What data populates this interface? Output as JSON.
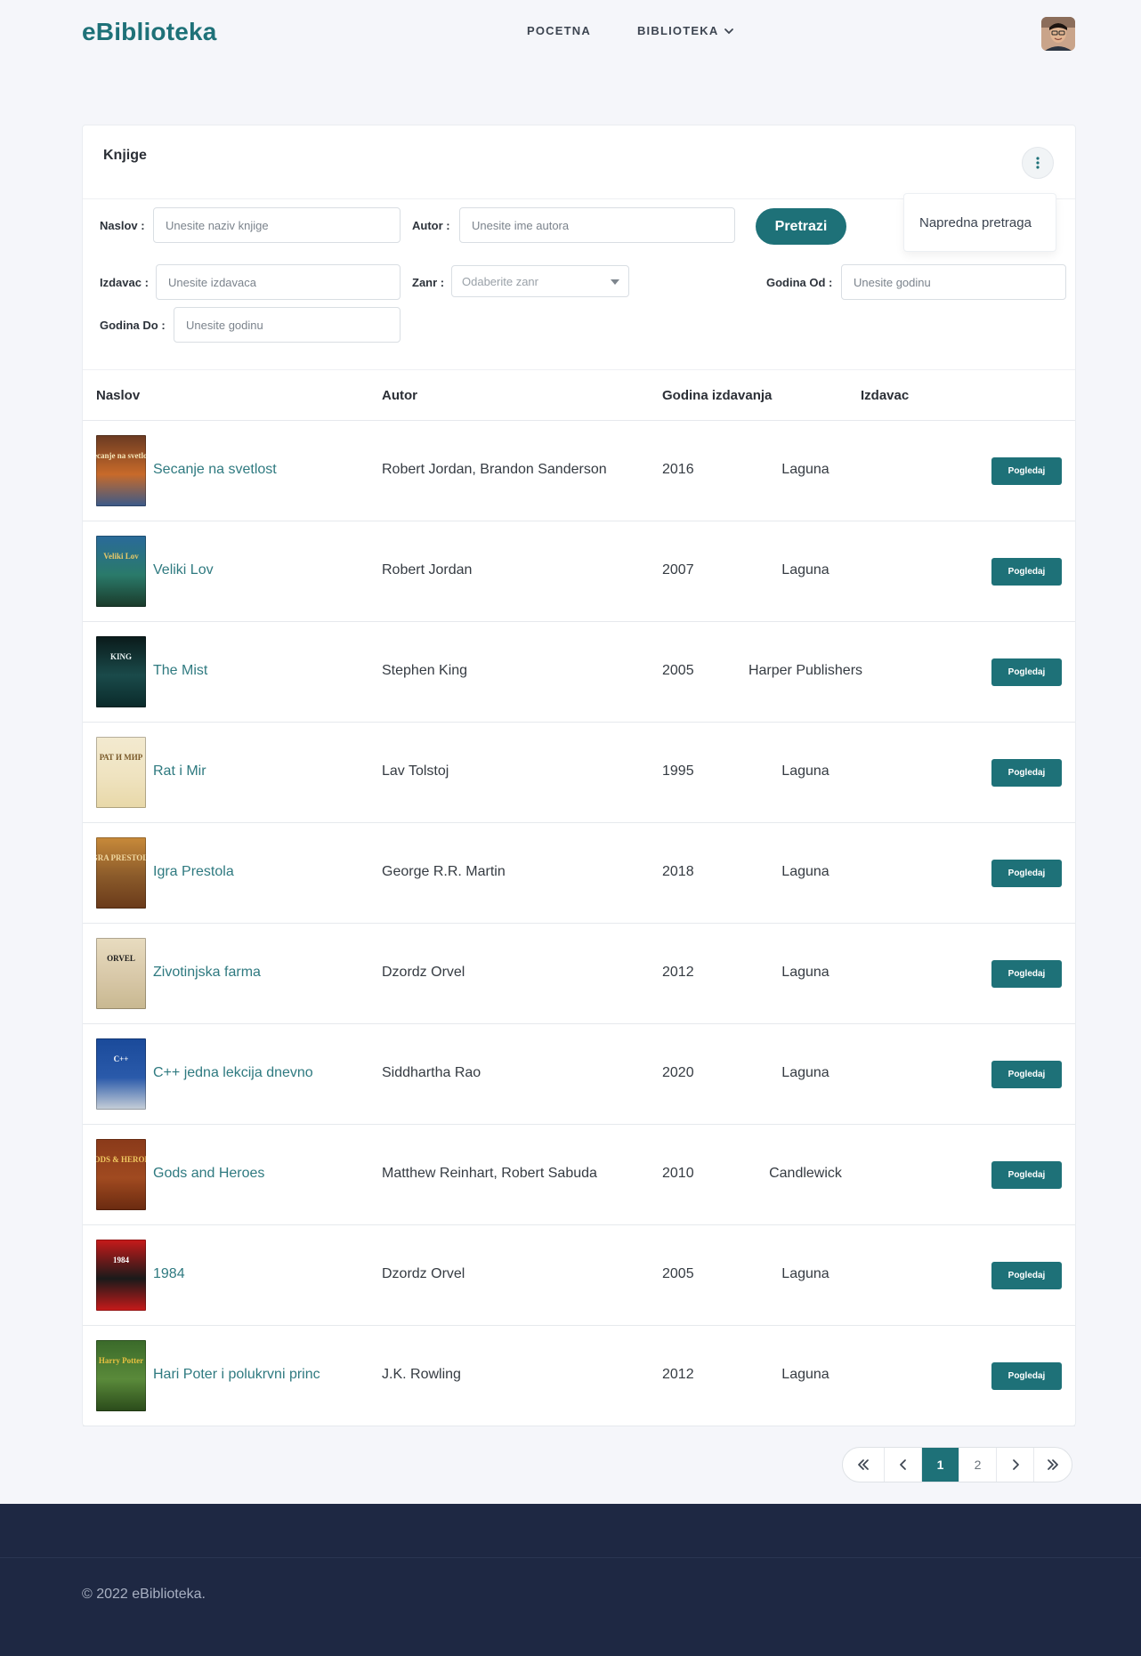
{
  "header": {
    "brand": "eBiblioteka",
    "nav": [
      {
        "label": "POCETNA"
      },
      {
        "label": "BIBLIOTEKA"
      }
    ]
  },
  "card": {
    "title": "Knjige",
    "menu_item": "Napredna pretraga"
  },
  "filters": {
    "naslov_label": "Naslov :",
    "naslov_placeholder": "Unesite naziv knjige",
    "autor_label": "Autor :",
    "autor_placeholder": "Unesite ime autora",
    "search_button": "Pretrazi",
    "izdavac_label": "Izdavac :",
    "izdavac_placeholder": "Unesite izdavaca",
    "zanr_label": "Zanr :",
    "zanr_placeholder": "Odaberite zanr",
    "godina_od_label": "Godina Od :",
    "godina_od_placeholder": "Unesite godinu",
    "godina_do_label": "Godina Do :",
    "godina_do_placeholder": "Unesite godinu"
  },
  "table": {
    "columns": [
      "Naslov",
      "Autor",
      "Godina izdavanja",
      "Izdavac"
    ],
    "view_label": "Pogledaj",
    "rows": [
      {
        "title": "Secanje na svetlost",
        "author": "Robert Jordan, Brandon Sanderson",
        "year": "2016",
        "publisher": "Laguna",
        "cover": {
          "top": "#6a3a22",
          "mid": "#c86a2a",
          "bottom": "#3a5a8a",
          "text": "Secanje na svetlost",
          "text_color": "#f5e6b8"
        }
      },
      {
        "title": "Veliki Lov",
        "author": "Robert Jordan",
        "year": "2007",
        "publisher": "Laguna",
        "cover": {
          "top": "#2a6a9a",
          "mid": "#2a7a6a",
          "bottom": "#1a3a2a",
          "text": "Veliki Lov",
          "text_color": "#e8c86a"
        }
      },
      {
        "title": "The Mist",
        "author": "Stephen King",
        "year": "2005",
        "publisher": "Harper Publishers",
        "cover": {
          "top": "#0a1a1a",
          "mid": "#1a4a4a",
          "bottom": "#0a2a2a",
          "text": "KING",
          "text_color": "#e8f0f0"
        }
      },
      {
        "title": "Rat i Mir",
        "author": "Lav Tolstoj",
        "year": "1995",
        "publisher": "Laguna",
        "cover": {
          "top": "#f3ead0",
          "mid": "#efe3c0",
          "bottom": "#e8d8a8",
          "text": "РАТ И МИР",
          "text_color": "#7a5a2a"
        }
      },
      {
        "title": "Igra Prestola",
        "author": "George R.R. Martin",
        "year": "2018",
        "publisher": "Laguna",
        "cover": {
          "top": "#c88a3a",
          "mid": "#8a5a2a",
          "bottom": "#6a3a1a",
          "text": "IGRA PRESTOLA",
          "text_color": "#f0d8a0"
        }
      },
      {
        "title": "Zivotinjska farma",
        "author": "Dzordz Orvel",
        "year": "2012",
        "publisher": "Laguna",
        "cover": {
          "top": "#e8dcc0",
          "mid": "#d8c8a8",
          "bottom": "#c8b890",
          "text": "ORVEL",
          "text_color": "#1a1a1a"
        }
      },
      {
        "title": "C++ jedna lekcija dnevno",
        "author": "Siddhartha Rao",
        "year": "2020",
        "publisher": "Laguna",
        "cover": {
          "top": "#1a4a9a",
          "mid": "#2a5aaa",
          "bottom": "#c8d0d8",
          "text": "C++",
          "text_color": "#ffffff"
        }
      },
      {
        "title": "Gods and Heroes",
        "author": "Matthew Reinhart, Robert Sabuda",
        "year": "2010",
        "publisher": "Candlewick",
        "cover": {
          "top": "#8a3a1a",
          "mid": "#a04a20",
          "bottom": "#6a2a10",
          "text": "GODS & HEROES",
          "text_color": "#f0c860"
        }
      },
      {
        "title": "1984",
        "author": "Dzordz Orvel",
        "year": "2005",
        "publisher": "Laguna",
        "cover": {
          "top": "#c81a1a",
          "mid": "#1a1a1a",
          "bottom": "#c81a1a",
          "text": "1984",
          "text_color": "#ffffff"
        }
      },
      {
        "title": "Hari Poter i polukrvni princ",
        "author": "J.K. Rowling",
        "year": "2012",
        "publisher": "Laguna",
        "cover": {
          "top": "#3a6a2a",
          "mid": "#5a8a3a",
          "bottom": "#2a4a1a",
          "text": "Harry Potter",
          "text_color": "#e8c040"
        }
      }
    ]
  },
  "pagination": {
    "first": "«",
    "prev": "‹",
    "pages": [
      "1",
      "2"
    ],
    "current": "1",
    "next": "›",
    "last": "»"
  },
  "footer": {
    "copyright": "© 2022 eBiblioteka."
  },
  "colors": {
    "accent": "#1e7178",
    "footer_bg": "#1e2843",
    "page_bg": "#f5f6fa"
  }
}
